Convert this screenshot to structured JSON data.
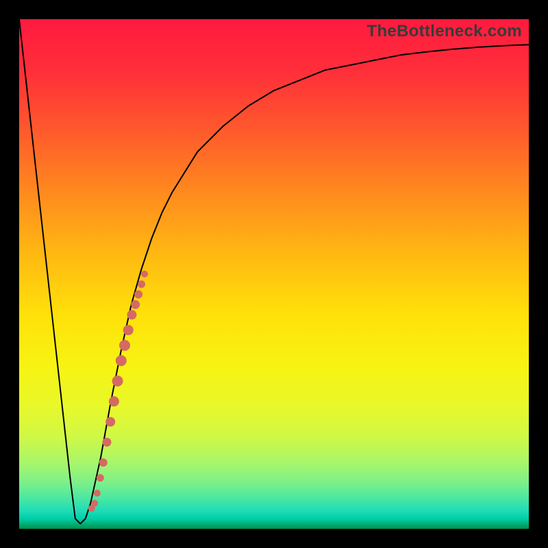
{
  "watermark": "TheBottleneck.com",
  "colors": {
    "frame": "#000000",
    "curve_stroke": "#000000",
    "dot_fill": "#d46a62"
  },
  "chart_data": {
    "type": "line",
    "title": "",
    "xlabel": "",
    "ylabel": "",
    "xlim": [
      0,
      100
    ],
    "ylim": [
      0,
      100
    ],
    "series": [
      {
        "name": "bottleneck-curve",
        "x": [
          0,
          2,
          4,
          6,
          8,
          10,
          11,
          12,
          13,
          14,
          16,
          18,
          20,
          22,
          24,
          26,
          28,
          30,
          35,
          40,
          45,
          50,
          55,
          60,
          65,
          70,
          75,
          80,
          85,
          90,
          95,
          100
        ],
        "values": [
          100,
          82,
          64,
          46,
          28,
          10,
          2,
          1,
          2,
          5,
          14,
          25,
          35,
          44,
          51,
          57,
          62,
          66,
          74,
          79,
          83,
          86,
          88,
          90,
          91,
          92,
          93,
          93.6,
          94.1,
          94.5,
          94.8,
          95
        ]
      }
    ],
    "dots": {
      "name": "highlighted-points",
      "x": [
        14.2,
        14.8,
        15.3,
        15.9,
        16.5,
        17.2,
        17.9,
        18.6,
        19.3,
        20.0,
        20.7,
        21.4,
        22.1,
        22.8,
        23.4,
        24.0,
        24.6
      ],
      "y": [
        4,
        5,
        7,
        10,
        13,
        17,
        21,
        25,
        29,
        33,
        36,
        39,
        42,
        44,
        46,
        48,
        50
      ],
      "r": [
        5,
        5,
        5,
        5.5,
        6,
        6.5,
        7,
        7.5,
        8,
        8,
        8,
        7.5,
        7,
        6.5,
        6,
        5.5,
        5
      ]
    }
  }
}
